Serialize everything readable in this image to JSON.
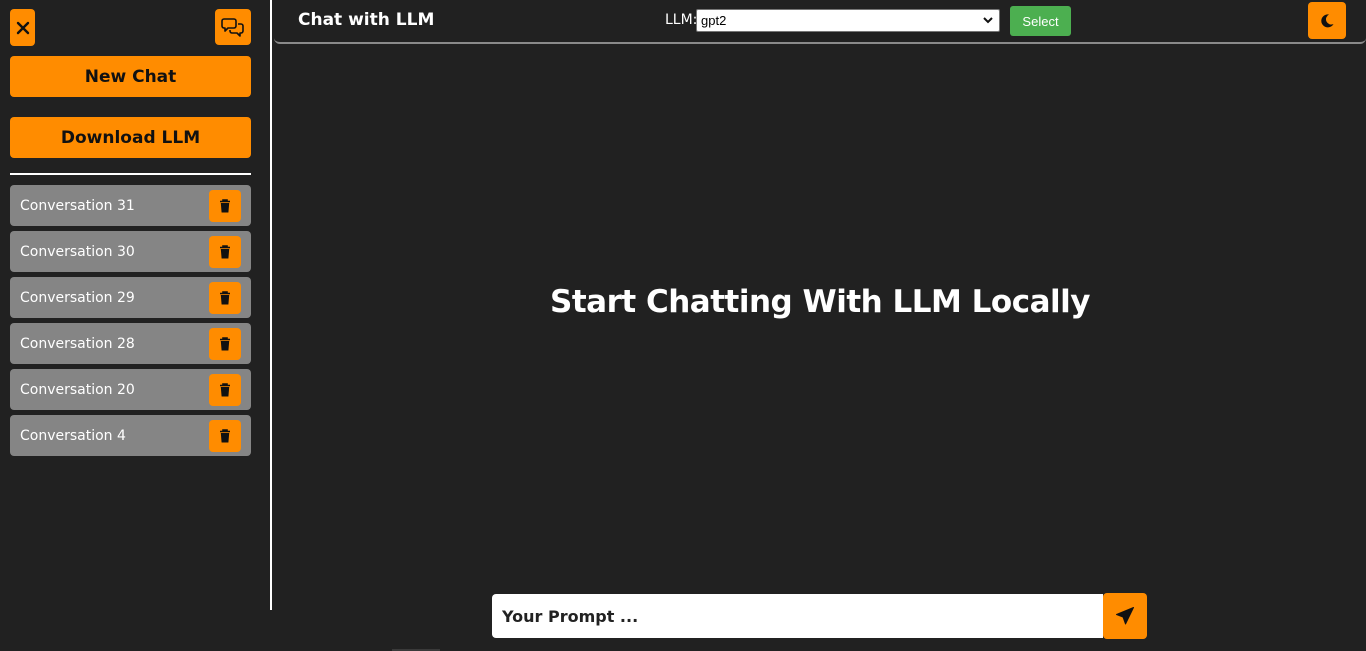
{
  "colors": {
    "accent": "#ff8c00",
    "background": "#212121",
    "conversation_item": "#858585",
    "select_button": "#4caf50"
  },
  "sidebar": {
    "close_icon": "close-icon",
    "conversations_icon": "chat-bubbles-icon",
    "new_chat_label": "New Chat",
    "download_label": "Download LLM",
    "conversations": [
      {
        "label": "Conversation 31"
      },
      {
        "label": "Conversation 30"
      },
      {
        "label": "Conversation 29"
      },
      {
        "label": "Conversation 28"
      },
      {
        "label": "Conversation 20"
      },
      {
        "label": "Conversation 4"
      }
    ],
    "delete_icon": "trash-icon"
  },
  "header": {
    "title": "Chat with LLM",
    "llm_label": "LLM:",
    "llm_selected": "gpt2",
    "select_label": "Select",
    "theme_icon": "moon-icon"
  },
  "main": {
    "hero_title": "Start Chatting With LLM Locally",
    "prompt_placeholder": "Your Prompt ...",
    "send_icon": "send-icon"
  }
}
